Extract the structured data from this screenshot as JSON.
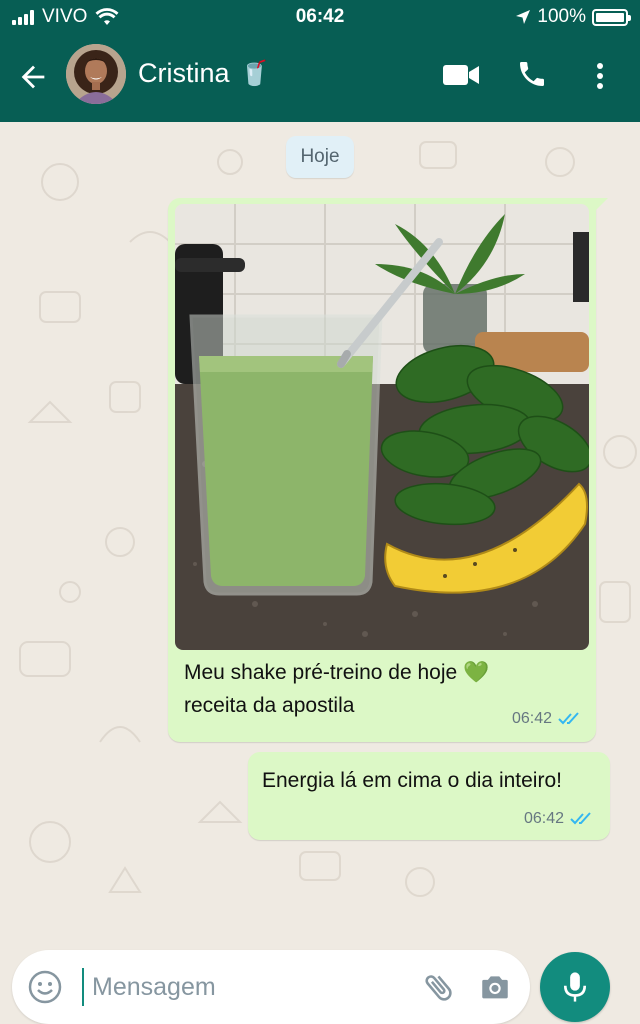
{
  "status_bar": {
    "carrier": "VIVO",
    "time": "06:42",
    "battery": "100%",
    "battery_level": 1.0
  },
  "header": {
    "contact_name": "Cristina",
    "contact_emoji": "🥤",
    "icons": [
      "back-arrow-icon",
      "video-call-icon",
      "phone-icon",
      "more-vert-icon"
    ]
  },
  "chat": {
    "date_chip": "Hoje",
    "messages": [
      {
        "type": "image",
        "text_line1": "Meu shake pré-treino de hoje 💚",
        "text_line2": "receita da apostila",
        "time": "06:42",
        "status": "read"
      },
      {
        "type": "text",
        "text": "Energia lá em cima o dia inteiro!",
        "time": "06:42",
        "status": "read"
      }
    ]
  },
  "input": {
    "placeholder": "Mensagem",
    "value": "",
    "icons": [
      "emoji-icon",
      "attach-icon",
      "camera-icon",
      "mic-icon"
    ]
  },
  "colors": {
    "header": "#075e54",
    "outgoing_bubble": "#dcf8c6",
    "accent": "#128c7e",
    "read_ticks": "#34b7f1",
    "chat_background": "#efeae2"
  }
}
